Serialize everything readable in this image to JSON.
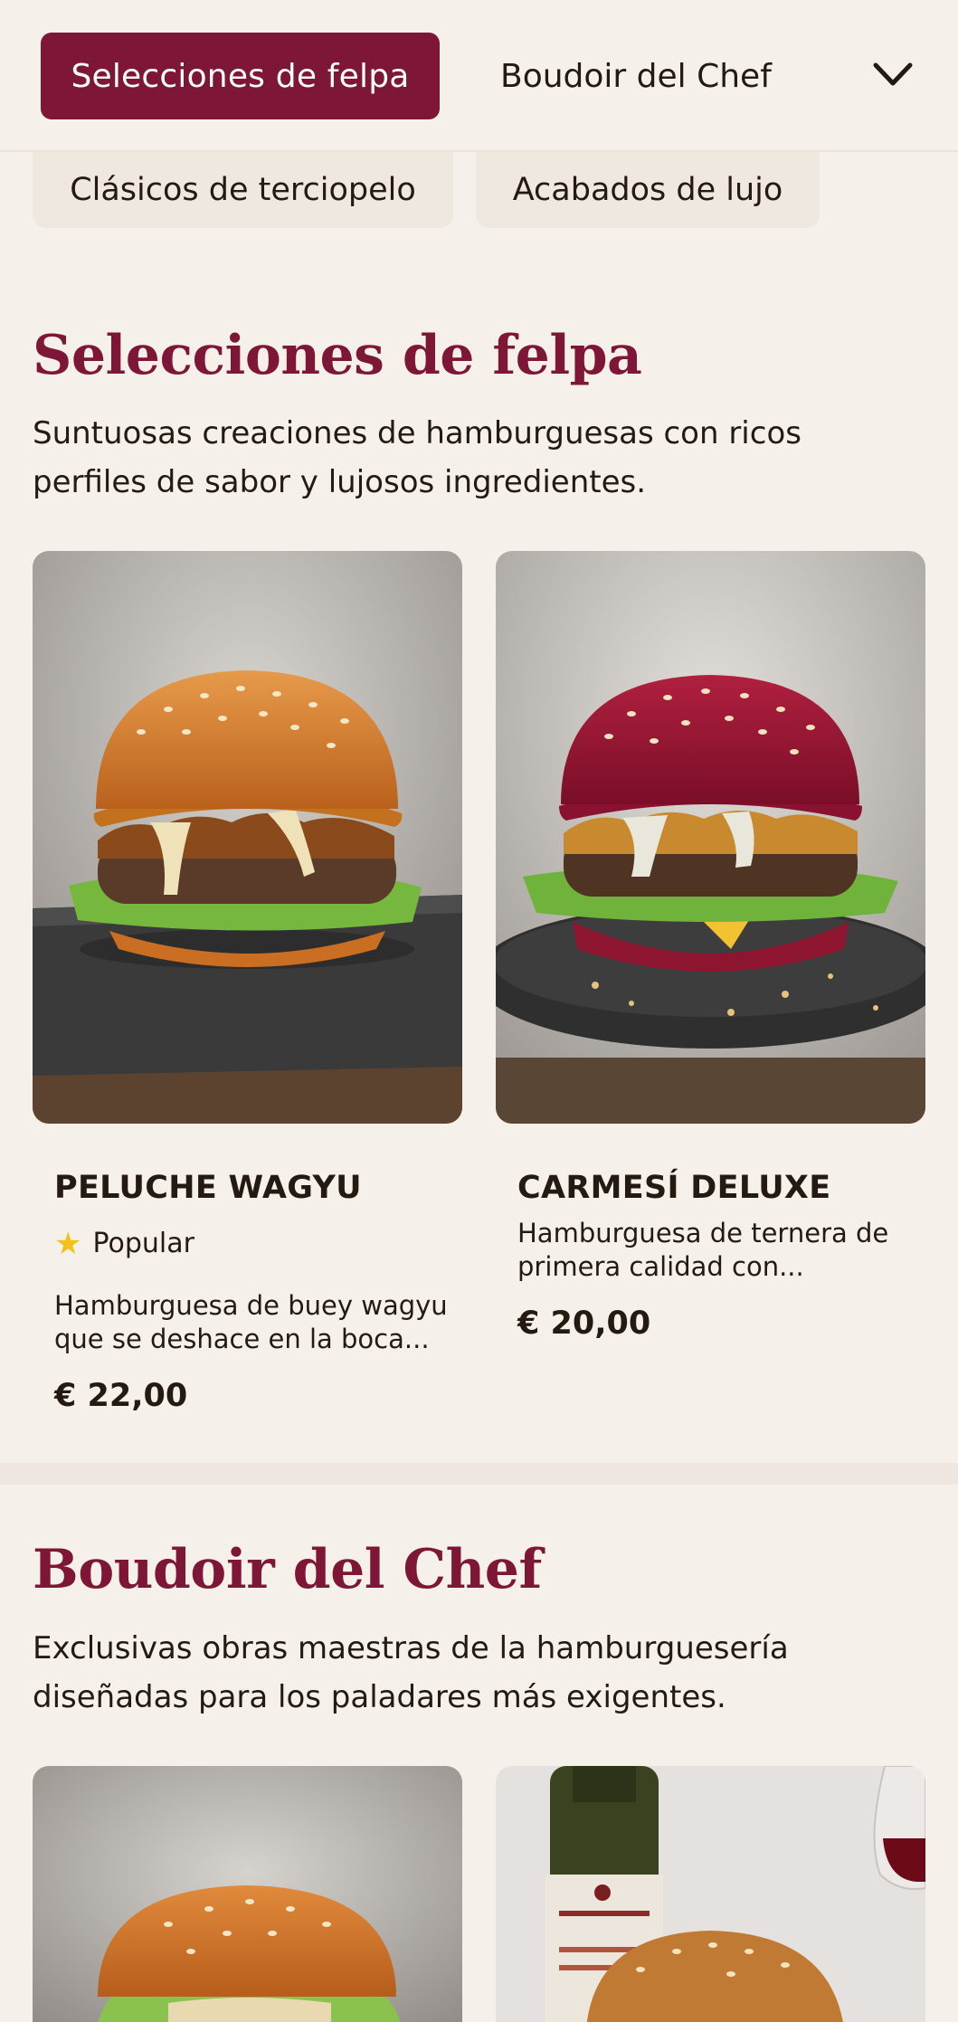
{
  "nav": {
    "active_tab": "Selecciones de felpa",
    "second_tab": "Boudoir del Chef",
    "chips": [
      "Clásicos de terciopelo",
      "Acabados de lujo"
    ]
  },
  "sections": [
    {
      "title": "Selecciones de felpa",
      "description": "Suntuosas creaciones de hamburguesas con ricos perfiles de sabor y lujosos ingredientes.",
      "items": [
        {
          "name": "PELUCHE WAGYU",
          "badge": "Popular",
          "description": "Hamburguesa de buey wagyu que se deshace en la boca...",
          "price": "€ 22,00"
        },
        {
          "name": "CARMESÍ DELUXE",
          "description": "Hamburguesa de ternera de primera calidad con...",
          "price": "€ 20,00"
        }
      ]
    },
    {
      "title": "Boudoir del Chef",
      "description": "Exclusivas obras maestras de la hamburguesería diseñadas para los paladares más exigentes."
    }
  ],
  "colors": {
    "accent": "#7e1737",
    "background": "#f5f1ea",
    "star": "#f2c21a"
  },
  "icons": [
    "chevron-down-icon",
    "star-icon"
  ]
}
